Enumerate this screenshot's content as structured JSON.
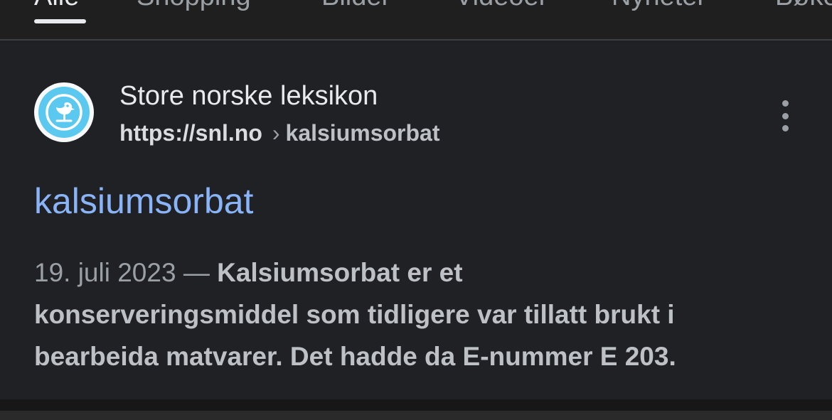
{
  "tabs": {
    "all": "Alle",
    "shopping": "Shopping",
    "images": "Bilder",
    "videos": "Videoer",
    "news": "Nyheter",
    "more": "Bøker"
  },
  "result": {
    "favicon_icon": "snl-bird-icon",
    "site_name": "Store norske leksikon",
    "domain": "https://snl.no",
    "separator": "›",
    "path": "kalsiumsorbat",
    "more_icon": "vertical-ellipsis-icon",
    "title": "kalsiumsorbat",
    "date": "19. juli 2023",
    "date_sep": " — ",
    "snippet_line1": "Kalsiumsorbat er et",
    "snippet_line2": "konserveringsmiddel som tidligere var tillatt brukt i",
    "snippet_line3": "bearbeida matvarer. Det hadde da E-nummer E 203."
  },
  "colors": {
    "background": "#202124",
    "link": "#8ab4f8",
    "favicon_blue": "#5bc8f0"
  }
}
